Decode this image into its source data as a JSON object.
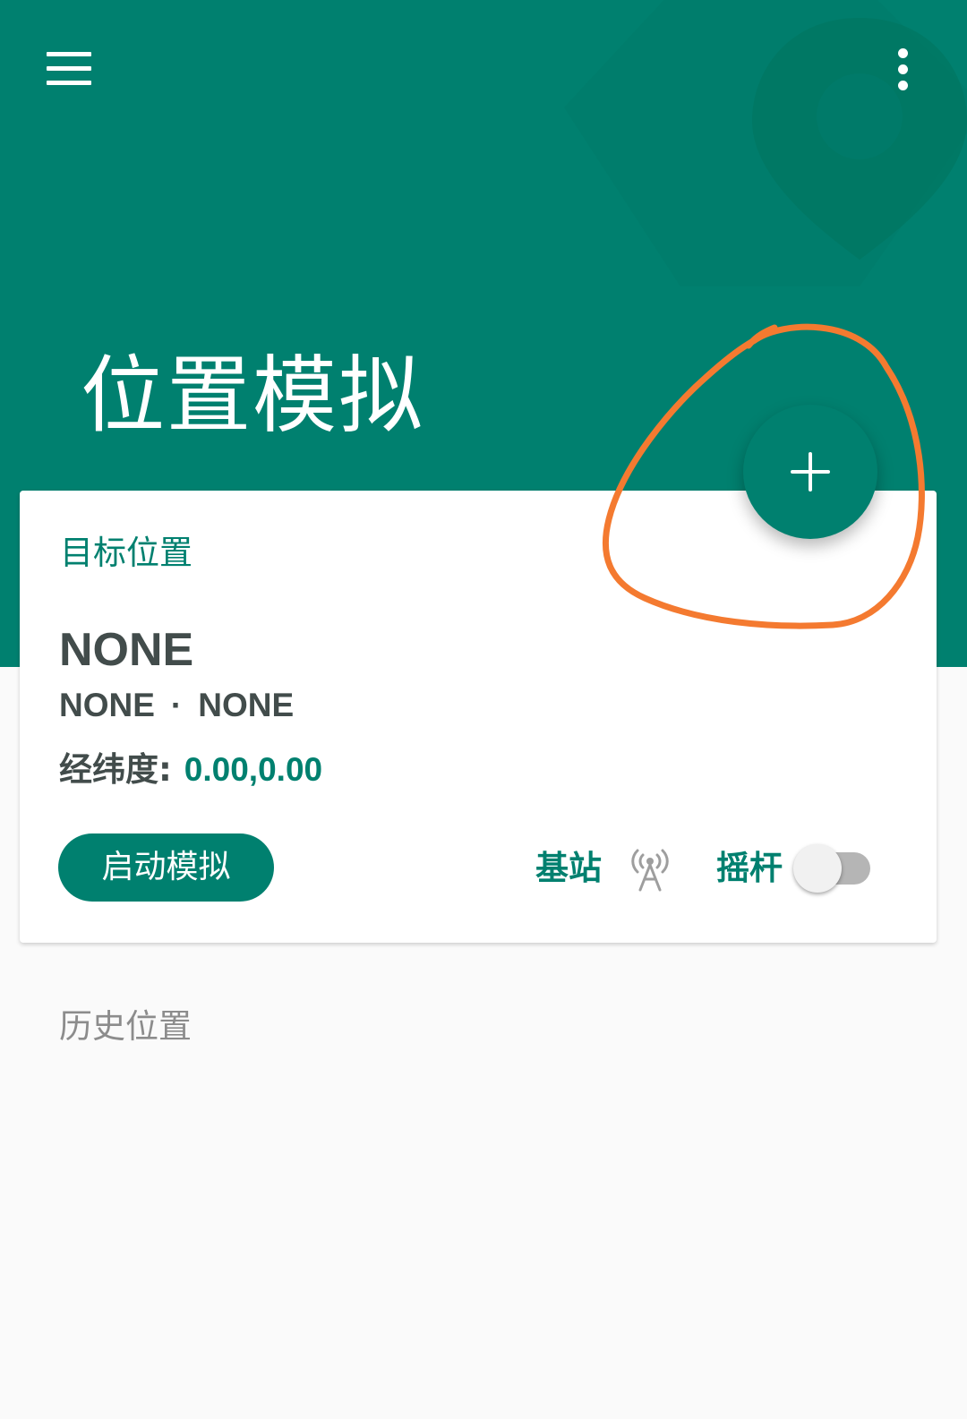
{
  "colors": {
    "primary": "#00806f",
    "annotation": "#f47a30",
    "text_dark": "#424c4b",
    "text_muted": "#8c8c8c",
    "background": "#fafafa"
  },
  "toolbar": {
    "menu_icon": "hamburger-menu-icon",
    "more_icon": "more-vertical-icon"
  },
  "header": {
    "title": "位置模拟",
    "background_icon": "location-pin-icon"
  },
  "fab": {
    "icon": "plus-icon"
  },
  "target_card": {
    "label": "目标位置",
    "location_name": "NONE",
    "region": "NONE",
    "separator": "·",
    "city": "NONE",
    "coords_label": "经纬度:",
    "coords_value": "0.00,0.00",
    "start_button_label": "启动模拟",
    "base_station_label": "基站",
    "base_station_icon": "cell-tower-icon",
    "joystick_label": "摇杆",
    "joystick_enabled": false
  },
  "history": {
    "label": "历史位置"
  }
}
